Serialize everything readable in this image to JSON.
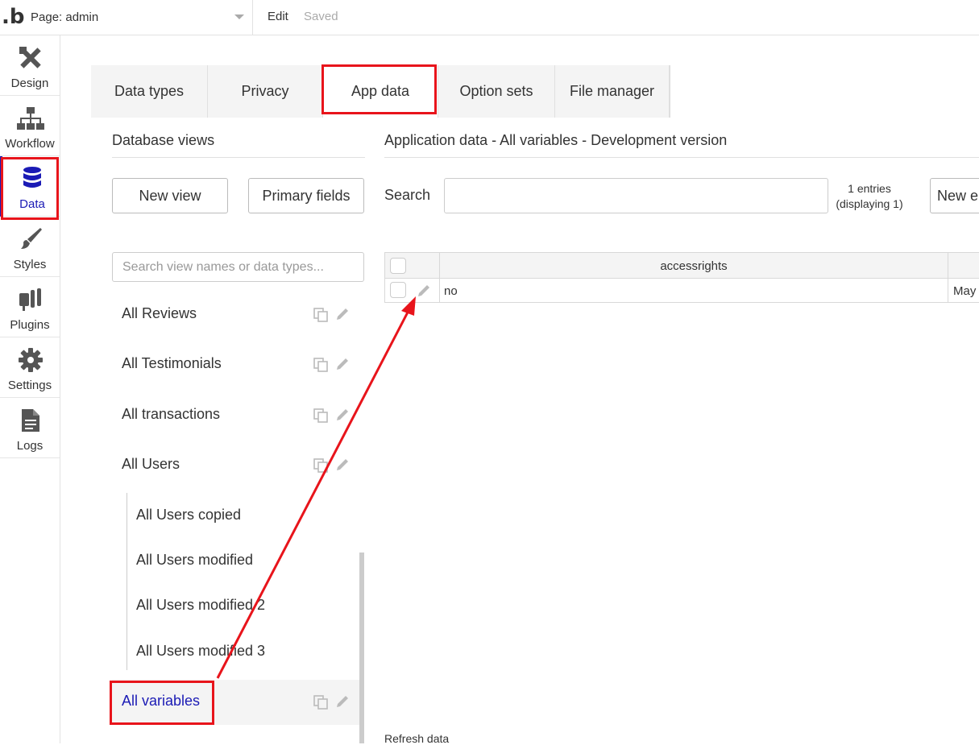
{
  "topbar": {
    "logo": ".b",
    "page_label": "Page: admin",
    "edit_label": "Edit",
    "saved_label": "Saved"
  },
  "sidebar": {
    "items": [
      {
        "label": "Design",
        "icon": "design-icon"
      },
      {
        "label": "Workflow",
        "icon": "workflow-icon"
      },
      {
        "label": "Data",
        "icon": "database-icon",
        "active": true
      },
      {
        "label": "Styles",
        "icon": "brush-icon"
      },
      {
        "label": "Plugins",
        "icon": "plug-icon"
      },
      {
        "label": "Settings",
        "icon": "gear-icon"
      },
      {
        "label": "Logs",
        "icon": "document-icon"
      }
    ]
  },
  "tabs": [
    {
      "label": "Data types"
    },
    {
      "label": "Privacy"
    },
    {
      "label": "App data",
      "active": true
    },
    {
      "label": "Option sets"
    },
    {
      "label": "File manager"
    }
  ],
  "left_panel": {
    "title": "Database views",
    "new_view_label": "New view",
    "primary_fields_label": "Primary fields",
    "search_placeholder": "Search view names or data types...",
    "views": [
      {
        "name": "All Reviews"
      },
      {
        "name": "All Testimonials"
      },
      {
        "name": "All transactions"
      },
      {
        "name": "All Users"
      },
      {
        "name": "All Users copied",
        "sub": true
      },
      {
        "name": "All Users modified",
        "sub": true
      },
      {
        "name": "All Users modified 2",
        "sub": true
      },
      {
        "name": "All Users modified 3",
        "sub": true
      },
      {
        "name": "All variables",
        "selected": true
      }
    ]
  },
  "right_panel": {
    "title": "Application data - All variables - Development version",
    "search_label": "Search",
    "entries_line1": "1 entries",
    "entries_line2": "(displaying 1)",
    "new_entry_label": "New entry",
    "columns": [
      "accessrights"
    ],
    "rows": [
      {
        "accessrights": "no",
        "date": "May"
      }
    ],
    "refresh_label": "Refresh data"
  },
  "colors": {
    "accent": "#1b1bb5",
    "highlight": "#e8141b",
    "tab_bg": "#f4f4f4"
  }
}
